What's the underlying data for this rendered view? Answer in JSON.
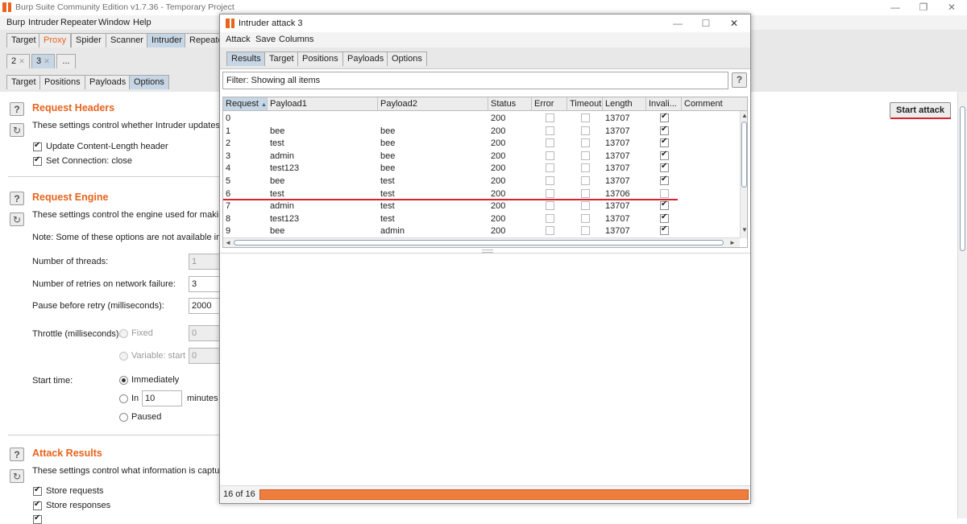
{
  "main_window": {
    "title": "Burp Suite Community Edition v1.7.36 - Temporary Project",
    "menu": [
      "Burp",
      "Intruder",
      "Repeater",
      "Window",
      "Help"
    ],
    "tabs": [
      "Target",
      "Proxy",
      "Spider",
      "Scanner",
      "Intruder",
      "Repeate"
    ],
    "attack_tabs": [
      "2",
      "3",
      "..."
    ],
    "sub_tabs": [
      "Target",
      "Positions",
      "Payloads",
      "Options"
    ],
    "start_attack_label": "Start attack"
  },
  "request_headers": {
    "title": "Request Headers",
    "desc": "These settings control whether Intruder updates the",
    "opt1": "Update Content-Length header",
    "opt2": "Set Connection: close"
  },
  "request_engine": {
    "title": "Request Engine",
    "desc": "These settings control the engine used for making H",
    "note": "Note: Some of these options are not available in the",
    "threads_label": "Number of threads:",
    "threads_value": "1",
    "retries_label": "Number of retries on network failure:",
    "retries_value": "3",
    "pause_label": "Pause before retry (milliseconds):",
    "pause_value": "2000",
    "throttle_label": "Throttle (milliseconds):",
    "fixed_label": "Fixed",
    "fixed_value": "0",
    "variable_label": "Variable:  start",
    "variable_value": "0",
    "start_time_label": "Start time:",
    "immediately_label": "Immediately",
    "in_label": "In",
    "in_value": "10",
    "minutes_label": "minutes",
    "paused_label": "Paused"
  },
  "attack_results": {
    "title": "Attack Results",
    "desc": "These settings control what information is captured",
    "opt1": "Store requests",
    "opt2": "Store responses"
  },
  "attack_window": {
    "title": "Intruder attack 3",
    "menu": [
      "Attack",
      "Save",
      "Columns"
    ],
    "tabs": [
      "Results",
      "Target",
      "Positions",
      "Payloads",
      "Options"
    ],
    "filter": "Filter: Showing all items",
    "columns": [
      "Request",
      "Payload1",
      "Payload2",
      "Status",
      "Error",
      "Timeout",
      "Length",
      "Invali...",
      "Comment"
    ],
    "rows": [
      {
        "req": "0",
        "p1": "",
        "p2": "",
        "status": "200",
        "length": "13707",
        "invalid": true
      },
      {
        "req": "1",
        "p1": "bee",
        "p2": "bee",
        "status": "200",
        "length": "13707",
        "invalid": true
      },
      {
        "req": "2",
        "p1": "test",
        "p2": "bee",
        "status": "200",
        "length": "13707",
        "invalid": true
      },
      {
        "req": "3",
        "p1": "admin",
        "p2": "bee",
        "status": "200",
        "length": "13707",
        "invalid": true
      },
      {
        "req": "4",
        "p1": "test123",
        "p2": "bee",
        "status": "200",
        "length": "13707",
        "invalid": true
      },
      {
        "req": "5",
        "p1": "bee",
        "p2": "test",
        "status": "200",
        "length": "13707",
        "invalid": true
      },
      {
        "req": "6",
        "p1": "test",
        "p2": "test",
        "status": "200",
        "length": "13706",
        "invalid": false
      },
      {
        "req": "7",
        "p1": "admin",
        "p2": "test",
        "status": "200",
        "length": "13707",
        "invalid": true
      },
      {
        "req": "8",
        "p1": "test123",
        "p2": "test",
        "status": "200",
        "length": "13707",
        "invalid": true
      },
      {
        "req": "9",
        "p1": "bee",
        "p2": "admin",
        "status": "200",
        "length": "13707",
        "invalid": true
      }
    ],
    "progress_text": "16 of 16",
    "progress_fraction": 1.0
  },
  "colors": {
    "accent": "#e8631c",
    "annotation_red": "#d9232c",
    "progress": "#f26b2d",
    "selected_tab": "#c7d6e4"
  }
}
